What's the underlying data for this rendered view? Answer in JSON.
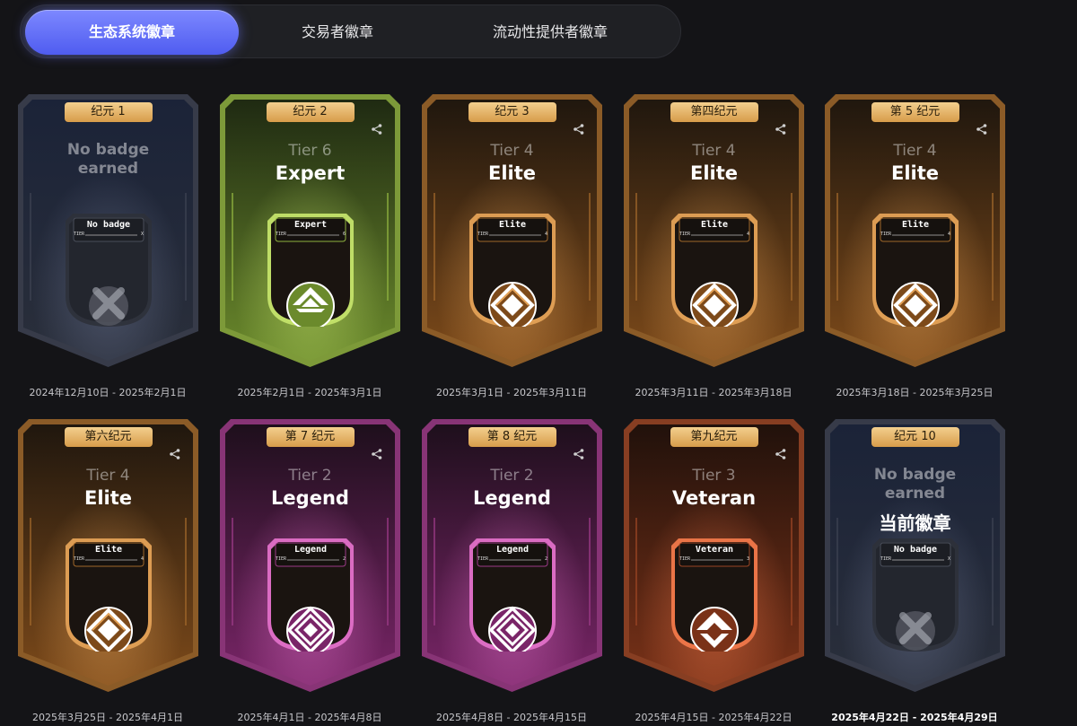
{
  "tabs": [
    {
      "label": "生态系统徽章",
      "active": true
    },
    {
      "label": "交易者徽章",
      "active": false
    },
    {
      "label": "流动性提供者徽章",
      "active": false
    }
  ],
  "badges": [
    {
      "season": "纪元 1",
      "state": "none",
      "no_badge_text": "No badge\nearned",
      "plate": "No badge",
      "plate_tier": "TIER",
      "plate_tier_value": "X",
      "date": "2024年12月10日 - 2025年2月1日",
      "theme": "blue",
      "icon": "x-icon"
    },
    {
      "season": "纪元 2",
      "state": "earned",
      "tier": "Tier 6",
      "level": "Expert",
      "plate": "Expert",
      "plate_tier": "TIER",
      "plate_tier_value": "6",
      "date": "2025年2月1日 - 2025年3月1日",
      "theme": "green",
      "icon": "expert-chevron-icon"
    },
    {
      "season": "纪元 3",
      "state": "earned",
      "tier": "Tier 4",
      "level": "Elite",
      "plate": "Elite",
      "plate_tier": "TIER",
      "plate_tier_value": "4",
      "date": "2025年3月1日 - 2025年3月11日",
      "theme": "bronze",
      "icon": "elite-diamond-icon"
    },
    {
      "season": "第四纪元",
      "state": "earned",
      "tier": "Tier 4",
      "level": "Elite",
      "plate": "Elite",
      "plate_tier": "TIER",
      "plate_tier_value": "4",
      "date": "2025年3月11日 - 2025年3月18日",
      "theme": "bronze",
      "icon": "elite-diamond-icon"
    },
    {
      "season": "第 5 纪元",
      "state": "earned",
      "tier": "Tier 4",
      "level": "Elite",
      "plate": "Elite",
      "plate_tier": "TIER",
      "plate_tier_value": "4",
      "date": "2025年3月18日 - 2025年3月25日",
      "theme": "bronze",
      "icon": "elite-diamond-icon"
    },
    {
      "season": "第六纪元",
      "state": "earned",
      "tier": "Tier 4",
      "level": "Elite",
      "plate": "Elite",
      "plate_tier": "TIER",
      "plate_tier_value": "4",
      "date": "2025年3月25日 - 2025年4月1日",
      "theme": "bronze",
      "icon": "elite-diamond-icon"
    },
    {
      "season": "第 7 纪元",
      "state": "earned",
      "tier": "Tier 2",
      "level": "Legend",
      "plate": "Legend",
      "plate_tier": "TIER",
      "plate_tier_value": "2",
      "date": "2025年4月1日 - 2025年4月8日",
      "theme": "purple",
      "icon": "legend-diamond-icon"
    },
    {
      "season": "第 8 纪元",
      "state": "earned",
      "tier": "Tier 2",
      "level": "Legend",
      "plate": "Legend",
      "plate_tier": "TIER",
      "plate_tier_value": "2",
      "date": "2025年4月8日 - 2025年4月15日",
      "theme": "purple",
      "icon": "legend-diamond-icon"
    },
    {
      "season": "第九纪元",
      "state": "earned",
      "tier": "Tier 3",
      "level": "Veteran",
      "plate": "Veteran",
      "plate_tier": "TIER",
      "plate_tier_value": "3",
      "date": "2025年4月15日 - 2025年4月22日",
      "theme": "red",
      "icon": "veteran-crest-icon"
    },
    {
      "season": "纪元 10",
      "state": "current",
      "no_badge_text": "No badge\nearned",
      "current_label": "当前徽章",
      "plate": "No badge",
      "plate_tier": "TIER",
      "plate_tier_value": "X",
      "date": "2025年4月22日 - 2025年4月29日",
      "theme": "blue",
      "icon": "x-icon"
    }
  ],
  "themes": {
    "blue": {
      "top": "#1b2338",
      "bottom": "#2a2f3b",
      "frame": "#3d4252",
      "glow": "#6a7390"
    },
    "green": {
      "top": "#1f2a12",
      "bottom": "#6b8a2c",
      "frame": "#8fb23f",
      "glow": "#c4e36a"
    },
    "bronze": {
      "top": "#20170e",
      "bottom": "#7d4a1a",
      "frame": "#a0672a",
      "glow": "#e3a156"
    },
    "purple": {
      "top": "#1e0f1c",
      "bottom": "#7a2568",
      "frame": "#9c3a87",
      "glow": "#e070c8"
    },
    "red": {
      "top": "#21110b",
      "bottom": "#7a3218",
      "frame": "#9b4524",
      "glow": "#f0784a"
    }
  }
}
